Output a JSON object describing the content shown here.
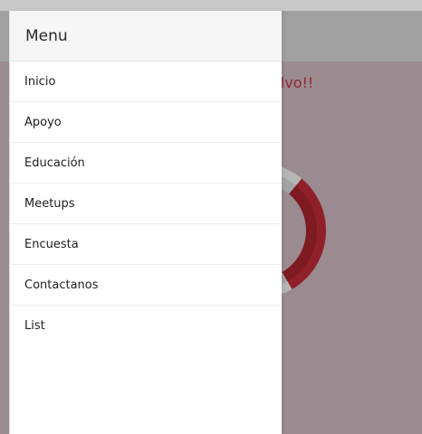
{
  "background": {
    "message": "alvo!!"
  },
  "drawer": {
    "title": "Menu",
    "items": [
      {
        "label": "Inicio"
      },
      {
        "label": "Apoyo"
      },
      {
        "label": "Educación"
      },
      {
        "label": "Meetups"
      },
      {
        "label": "Encuesta"
      },
      {
        "label": "Contactanos"
      },
      {
        "label": "List"
      }
    ]
  },
  "colors": {
    "overlay": "#9b8a90",
    "accent": "#8f2029",
    "topbar": "#a0a0a0",
    "drawer_bg": "#ffffff"
  }
}
